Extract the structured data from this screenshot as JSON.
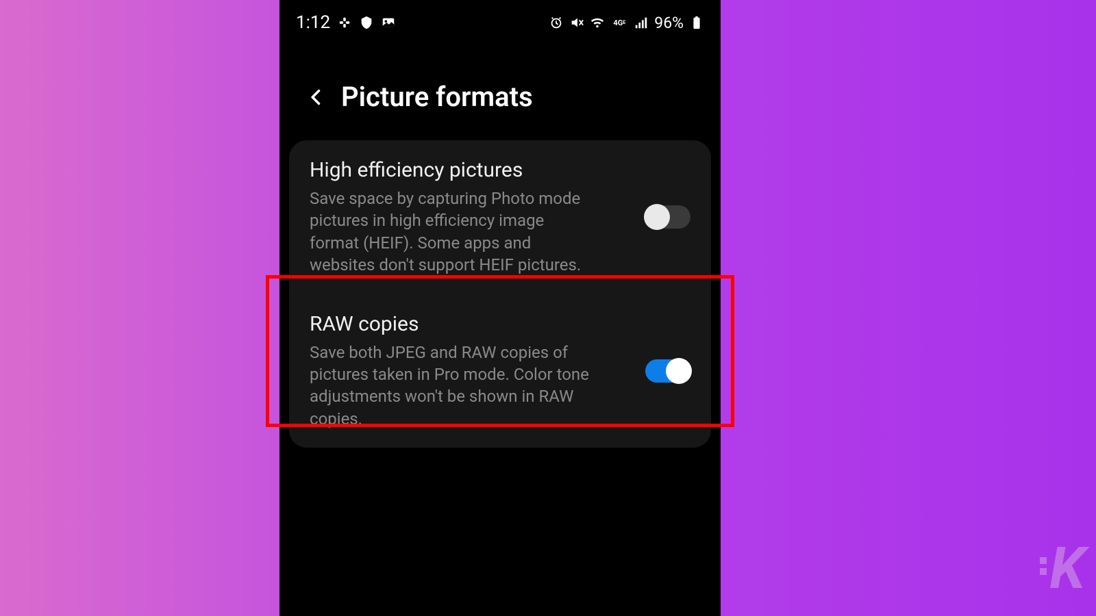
{
  "status_bar": {
    "time": "1:12",
    "battery_text": "96%"
  },
  "header": {
    "title": "Picture formats"
  },
  "settings": [
    {
      "title": "High efficiency pictures",
      "description": "Save space by capturing Photo mode pictures in high efficiency image format (HEIF). Some apps and websites don't support HEIF pictures.",
      "enabled": false
    },
    {
      "title": "RAW copies",
      "description": "Save both JPEG and RAW copies of pictures taken in Pro mode. Color tone adjustments won't be shown in RAW copies.",
      "enabled": true
    }
  ],
  "watermark": "K"
}
